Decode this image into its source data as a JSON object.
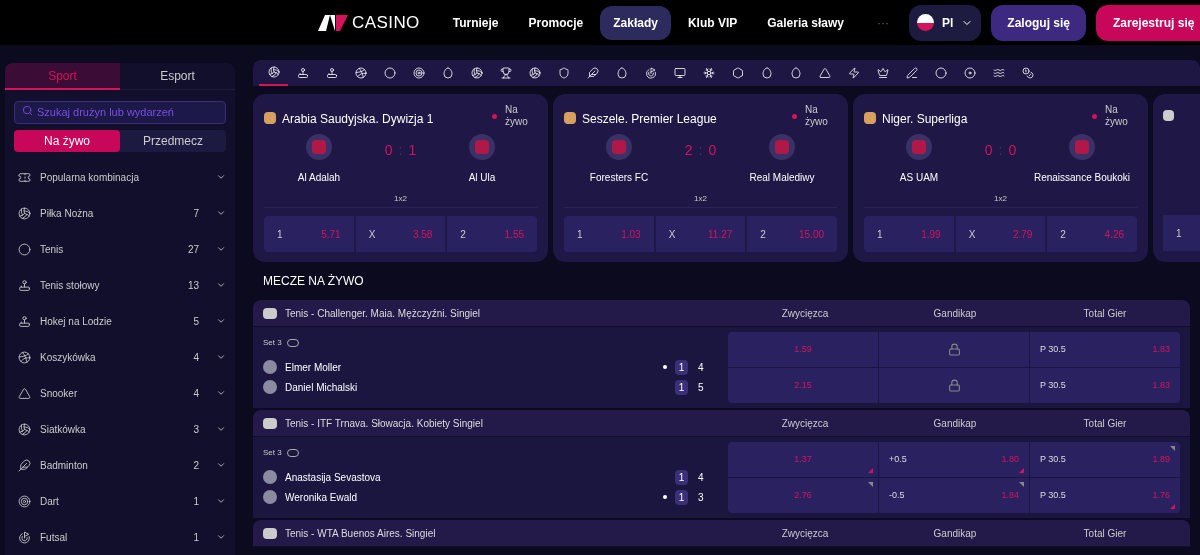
{
  "header": {
    "logo": "CASINO",
    "nav": [
      {
        "label": "Turnieje",
        "selected": false
      },
      {
        "label": "Promocje",
        "selected": false
      },
      {
        "label": "Zakłady",
        "selected": true
      },
      {
        "label": "Klub VIP",
        "selected": false
      },
      {
        "label": "Galeria sławy",
        "selected": false
      }
    ],
    "more": "···",
    "language": "Pl",
    "login": "Zaloguj się",
    "register": "Zarejestruj się"
  },
  "sidebar": {
    "tabs": [
      {
        "label": "Sport",
        "selected": true
      },
      {
        "label": "Esport",
        "selected": false
      }
    ],
    "search": {
      "placeholder": "Szukaj drużyn lub wydarzeń"
    },
    "modes": [
      {
        "label": "Na żywo",
        "selected": true
      },
      {
        "label": "Przedmecz",
        "selected": false
      }
    ],
    "categories": [
      {
        "kind": "ticket",
        "name": "Popularna kombinacja"
      },
      {
        "kind": "ball",
        "name": "Piłka Nożna",
        "count": "7"
      },
      {
        "kind": "circle",
        "name": "Tenis",
        "count": "27"
      },
      {
        "kind": "paddle",
        "name": "Tenis stołowy",
        "count": "13"
      },
      {
        "kind": "stick",
        "name": "Hokej na Lodzie",
        "count": "5"
      },
      {
        "kind": "basketball",
        "name": "Koszykówka",
        "count": "4"
      },
      {
        "kind": "triangle",
        "name": "Snooker",
        "count": "4"
      },
      {
        "kind": "volleyball",
        "name": "Siatkówka",
        "count": "3"
      },
      {
        "kind": "feather",
        "name": "Badminton",
        "count": "2"
      },
      {
        "kind": "target",
        "name": "Dart",
        "count": "1"
      },
      {
        "kind": "goal",
        "name": "Futsal",
        "count": "1"
      }
    ]
  },
  "sport_bar": [
    {
      "kind": "ball",
      "selected": true
    },
    {
      "kind": "stick",
      "selected": false
    },
    {
      "kind": "paddle",
      "selected": false
    },
    {
      "kind": "basketball",
      "selected": false
    },
    {
      "kind": "circle",
      "selected": false
    },
    {
      "kind": "target",
      "selected": false
    },
    {
      "kind": "egg",
      "selected": false
    },
    {
      "kind": "ball",
      "selected": false
    },
    {
      "kind": "trophy",
      "selected": false
    },
    {
      "kind": "volleyball",
      "selected": false
    },
    {
      "kind": "shield",
      "selected": false
    },
    {
      "kind": "feather",
      "selected": false
    },
    {
      "kind": "egg",
      "selected": false
    },
    {
      "kind": "goal",
      "selected": false
    },
    {
      "kind": "monitor",
      "selected": false
    },
    {
      "kind": "snowflake",
      "selected": false
    },
    {
      "kind": "hexagon",
      "selected": false
    },
    {
      "kind": "egg",
      "selected": false
    },
    {
      "kind": "egg",
      "selected": false
    },
    {
      "kind": "triangle",
      "selected": false
    },
    {
      "kind": "zap",
      "selected": false
    },
    {
      "kind": "crown",
      "selected": false
    },
    {
      "kind": "pen",
      "selected": false
    },
    {
      "kind": "racket",
      "selected": false
    },
    {
      "kind": "disc",
      "selected": false
    },
    {
      "kind": "waves",
      "selected": false
    },
    {
      "kind": "coin",
      "selected": false
    }
  ],
  "featured": [
    {
      "kind": "full",
      "league": "Arabia Saudyjska. Dywizja 1",
      "live": "Na żywo",
      "home": "Al Adalah",
      "away": "Al Ula",
      "score_home": "0",
      "score_sep": ":",
      "score_away": "1",
      "market": "1x2",
      "odds": [
        {
          "label": "1",
          "value": "5.71"
        },
        {
          "label": "X",
          "value": "3.58"
        },
        {
          "label": "2",
          "value": "1.55"
        }
      ]
    },
    {
      "kind": "full",
      "league": "Seszele. Premier League",
      "live": "Na żywo",
      "home": "Foresters FC",
      "away": "Real Malediwy",
      "score_home": "2",
      "score_sep": ":",
      "score_away": "0",
      "market": "1x2",
      "odds": [
        {
          "label": "1",
          "value": "1.03"
        },
        {
          "label": "X",
          "value": "11.27"
        },
        {
          "label": "2",
          "value": "15.00"
        }
      ]
    },
    {
      "kind": "full",
      "league": "Niger. Superliga",
      "live": "Na żywo",
      "home": "AS UAM",
      "away": "Renaissance Boukoki",
      "score_home": "0",
      "score_sep": ":",
      "score_away": "0",
      "market": "1x2",
      "odds": [
        {
          "label": "1",
          "value": "1.99"
        },
        {
          "label": "X",
          "value": "2.79"
        },
        {
          "label": "2",
          "value": "4.26"
        }
      ]
    },
    {
      "kind": "partial",
      "odds": [
        {
          "label": "1"
        }
      ]
    }
  ],
  "live_title": "MECZE NA ŻYWO",
  "matches": [
    {
      "league": "Tenis - Challenger. Maia. Mężczyźni. Singiel",
      "columns": [
        "Zwycięzca",
        "Gandikap",
        "Total Gier"
      ],
      "set": "Set 3",
      "players": [
        {
          "name": "Elmer Moller",
          "serving": true,
          "sets": "1",
          "games": "4",
          "winner": {
            "value": "1.59"
          },
          "handicap": {
            "locked": true
          },
          "total": {
            "line": "P 30.5",
            "value": "1.83"
          }
        },
        {
          "name": "Daniel Michalski",
          "serving": false,
          "sets": "1",
          "games": "5",
          "winner": {
            "value": "2.15"
          },
          "handicap": {
            "locked": true
          },
          "total": {
            "line": "P 30.5",
            "value": "1.83"
          }
        }
      ]
    },
    {
      "league": "Tenis - ITF Trnava. Słowacja. Kobiety Singiel",
      "columns": [
        "Zwycięzca",
        "Gandikap",
        "Total Gier"
      ],
      "set": "Set 3",
      "players": [
        {
          "name": "Anastasija Sevastova",
          "serving": false,
          "sets": "1",
          "games": "4",
          "winner": {
            "value": "1.37",
            "rising": true
          },
          "handicap": {
            "locked": false,
            "line": "+0.5",
            "value": "1.80",
            "rising": true
          },
          "total": {
            "line": "P 30.5",
            "value": "1.89",
            "rising": false
          }
        },
        {
          "name": "Weronika Ewald",
          "serving": true,
          "sets": "1",
          "games": "3",
          "winner": {
            "value": "2.76",
            "rising": false
          },
          "handicap": {
            "locked": false,
            "line": "-0.5",
            "value": "1.84",
            "rising": false
          },
          "total": {
            "line": "P 30.5",
            "value": "1.76",
            "rising": true
          }
        }
      ]
    },
    {
      "league": "Tenis - WTA Buenos Aires. Singiel",
      "columns": [
        "Zwycięzca",
        "Gandikap",
        "Total Gier"
      ]
    }
  ]
}
